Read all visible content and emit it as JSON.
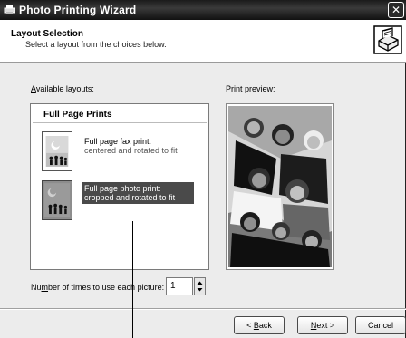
{
  "window": {
    "title": "Photo Printing Wizard",
    "close_label": "✕"
  },
  "header": {
    "title": "Layout Selection",
    "subtitle": "Select a layout from the choices below."
  },
  "layouts": {
    "label_prefix": "",
    "label_underlined": "A",
    "label_rest": "vailable layouts:",
    "group_title": "Full Page Prints",
    "items": [
      {
        "line1": "Full page fax print:",
        "line2": "centered and rotated to fit",
        "selected": false
      },
      {
        "line1": "Full page photo print:",
        "line2": "cropped and rotated to fit",
        "selected": true
      }
    ]
  },
  "preview": {
    "label": "Print preview:"
  },
  "copies": {
    "label_prefix": "Nu",
    "label_underlined": "m",
    "label_rest": "ber of times to use each picture:",
    "value": "1"
  },
  "buttons": {
    "back_arrow": "< ",
    "back_underlined": "B",
    "back_rest": "ack",
    "next_underlined": "N",
    "next_rest": "ext >",
    "cancel": "Cancel"
  }
}
